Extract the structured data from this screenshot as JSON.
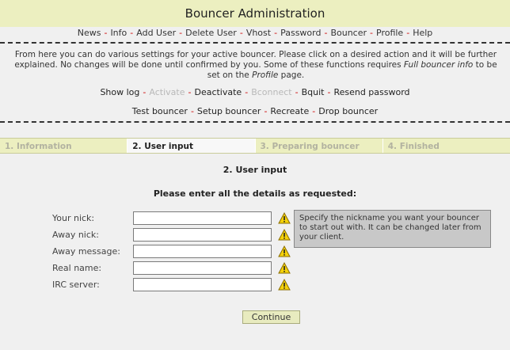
{
  "header": {
    "title": "Bouncer Administration"
  },
  "nav": {
    "items": [
      "News",
      "Info",
      "Add User",
      "Delete User",
      "Vhost",
      "Password",
      "Bouncer",
      "Profile",
      "Help"
    ]
  },
  "intro": {
    "part1": "From here you can do various settings for your active bouncer. Please click on a desired action and it will be further explained. No changes will be done until confirmed by you. Some of these functions requires ",
    "emph1": "Full bouncer info",
    "part2": " to be set on the ",
    "emph2": "Profile",
    "part3": " page."
  },
  "actions_row1": {
    "show_log": "Show log",
    "activate": "Activate",
    "deactivate": "Deactivate",
    "bconnect": "Bconnect",
    "bquit": "Bquit",
    "resend_password": "Resend password"
  },
  "actions_row2": {
    "test_bouncer": "Test bouncer",
    "setup_bouncer": "Setup bouncer",
    "recreate": "Recreate",
    "drop_bouncer": "Drop bouncer"
  },
  "steps": [
    "1. Information",
    "2. User input",
    "3. Preparing bouncer",
    "4. Finished"
  ],
  "active_step": 1,
  "section": {
    "title": "2. User input",
    "subtitle": "Please enter all the details as requested:"
  },
  "form": {
    "fields": [
      {
        "label": "Your nick:",
        "value": ""
      },
      {
        "label": "Away nick:",
        "value": ""
      },
      {
        "label": "Away message:",
        "value": ""
      },
      {
        "label": "Real name:",
        "value": ""
      },
      {
        "label": "IRC server:",
        "value": ""
      }
    ]
  },
  "tip": {
    "text": "Specify the nickname you want your bouncer to start out with. It can be changed later from your client."
  },
  "continue_button": "Continue",
  "colors": {
    "header_bg": "#ecefc0",
    "separator_red": "#cc0000",
    "warning_yellow": "#f5d20a",
    "disabled_text": "#b8b8b8"
  },
  "icons": {
    "field_status": "warning-icon"
  }
}
